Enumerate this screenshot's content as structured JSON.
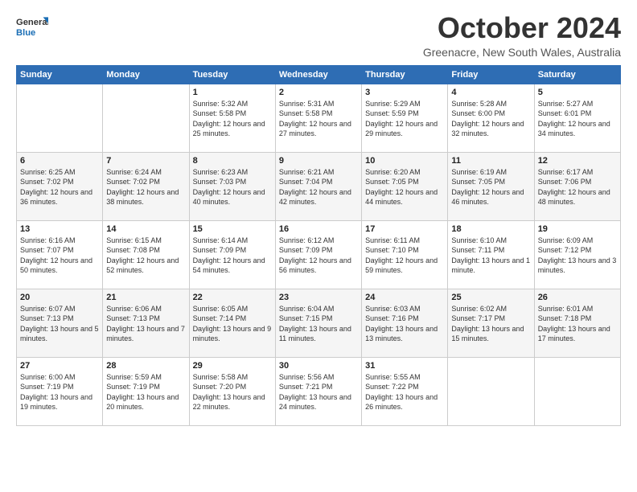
{
  "logo": {
    "general": "General",
    "blue": "Blue"
  },
  "header": {
    "month": "October 2024",
    "location": "Greenacre, New South Wales, Australia"
  },
  "weekdays": [
    "Sunday",
    "Monday",
    "Tuesday",
    "Wednesday",
    "Thursday",
    "Friday",
    "Saturday"
  ],
  "weeks": [
    [
      {
        "day": "",
        "sunrise": "",
        "sunset": "",
        "daylight": ""
      },
      {
        "day": "",
        "sunrise": "",
        "sunset": "",
        "daylight": ""
      },
      {
        "day": "1",
        "sunrise": "Sunrise: 5:32 AM",
        "sunset": "Sunset: 5:58 PM",
        "daylight": "Daylight: 12 hours and 25 minutes."
      },
      {
        "day": "2",
        "sunrise": "Sunrise: 5:31 AM",
        "sunset": "Sunset: 5:58 PM",
        "daylight": "Daylight: 12 hours and 27 minutes."
      },
      {
        "day": "3",
        "sunrise": "Sunrise: 5:29 AM",
        "sunset": "Sunset: 5:59 PM",
        "daylight": "Daylight: 12 hours and 29 minutes."
      },
      {
        "day": "4",
        "sunrise": "Sunrise: 5:28 AM",
        "sunset": "Sunset: 6:00 PM",
        "daylight": "Daylight: 12 hours and 32 minutes."
      },
      {
        "day": "5",
        "sunrise": "Sunrise: 5:27 AM",
        "sunset": "Sunset: 6:01 PM",
        "daylight": "Daylight: 12 hours and 34 minutes."
      }
    ],
    [
      {
        "day": "6",
        "sunrise": "Sunrise: 6:25 AM",
        "sunset": "Sunset: 7:02 PM",
        "daylight": "Daylight: 12 hours and 36 minutes."
      },
      {
        "day": "7",
        "sunrise": "Sunrise: 6:24 AM",
        "sunset": "Sunset: 7:02 PM",
        "daylight": "Daylight: 12 hours and 38 minutes."
      },
      {
        "day": "8",
        "sunrise": "Sunrise: 6:23 AM",
        "sunset": "Sunset: 7:03 PM",
        "daylight": "Daylight: 12 hours and 40 minutes."
      },
      {
        "day": "9",
        "sunrise": "Sunrise: 6:21 AM",
        "sunset": "Sunset: 7:04 PM",
        "daylight": "Daylight: 12 hours and 42 minutes."
      },
      {
        "day": "10",
        "sunrise": "Sunrise: 6:20 AM",
        "sunset": "Sunset: 7:05 PM",
        "daylight": "Daylight: 12 hours and 44 minutes."
      },
      {
        "day": "11",
        "sunrise": "Sunrise: 6:19 AM",
        "sunset": "Sunset: 7:05 PM",
        "daylight": "Daylight: 12 hours and 46 minutes."
      },
      {
        "day": "12",
        "sunrise": "Sunrise: 6:17 AM",
        "sunset": "Sunset: 7:06 PM",
        "daylight": "Daylight: 12 hours and 48 minutes."
      }
    ],
    [
      {
        "day": "13",
        "sunrise": "Sunrise: 6:16 AM",
        "sunset": "Sunset: 7:07 PM",
        "daylight": "Daylight: 12 hours and 50 minutes."
      },
      {
        "day": "14",
        "sunrise": "Sunrise: 6:15 AM",
        "sunset": "Sunset: 7:08 PM",
        "daylight": "Daylight: 12 hours and 52 minutes."
      },
      {
        "day": "15",
        "sunrise": "Sunrise: 6:14 AM",
        "sunset": "Sunset: 7:09 PM",
        "daylight": "Daylight: 12 hours and 54 minutes."
      },
      {
        "day": "16",
        "sunrise": "Sunrise: 6:12 AM",
        "sunset": "Sunset: 7:09 PM",
        "daylight": "Daylight: 12 hours and 56 minutes."
      },
      {
        "day": "17",
        "sunrise": "Sunrise: 6:11 AM",
        "sunset": "Sunset: 7:10 PM",
        "daylight": "Daylight: 12 hours and 59 minutes."
      },
      {
        "day": "18",
        "sunrise": "Sunrise: 6:10 AM",
        "sunset": "Sunset: 7:11 PM",
        "daylight": "Daylight: 13 hours and 1 minute."
      },
      {
        "day": "19",
        "sunrise": "Sunrise: 6:09 AM",
        "sunset": "Sunset: 7:12 PM",
        "daylight": "Daylight: 13 hours and 3 minutes."
      }
    ],
    [
      {
        "day": "20",
        "sunrise": "Sunrise: 6:07 AM",
        "sunset": "Sunset: 7:13 PM",
        "daylight": "Daylight: 13 hours and 5 minutes."
      },
      {
        "day": "21",
        "sunrise": "Sunrise: 6:06 AM",
        "sunset": "Sunset: 7:13 PM",
        "daylight": "Daylight: 13 hours and 7 minutes."
      },
      {
        "day": "22",
        "sunrise": "Sunrise: 6:05 AM",
        "sunset": "Sunset: 7:14 PM",
        "daylight": "Daylight: 13 hours and 9 minutes."
      },
      {
        "day": "23",
        "sunrise": "Sunrise: 6:04 AM",
        "sunset": "Sunset: 7:15 PM",
        "daylight": "Daylight: 13 hours and 11 minutes."
      },
      {
        "day": "24",
        "sunrise": "Sunrise: 6:03 AM",
        "sunset": "Sunset: 7:16 PM",
        "daylight": "Daylight: 13 hours and 13 minutes."
      },
      {
        "day": "25",
        "sunrise": "Sunrise: 6:02 AM",
        "sunset": "Sunset: 7:17 PM",
        "daylight": "Daylight: 13 hours and 15 minutes."
      },
      {
        "day": "26",
        "sunrise": "Sunrise: 6:01 AM",
        "sunset": "Sunset: 7:18 PM",
        "daylight": "Daylight: 13 hours and 17 minutes."
      }
    ],
    [
      {
        "day": "27",
        "sunrise": "Sunrise: 6:00 AM",
        "sunset": "Sunset: 7:19 PM",
        "daylight": "Daylight: 13 hours and 19 minutes."
      },
      {
        "day": "28",
        "sunrise": "Sunrise: 5:59 AM",
        "sunset": "Sunset: 7:19 PM",
        "daylight": "Daylight: 13 hours and 20 minutes."
      },
      {
        "day": "29",
        "sunrise": "Sunrise: 5:58 AM",
        "sunset": "Sunset: 7:20 PM",
        "daylight": "Daylight: 13 hours and 22 minutes."
      },
      {
        "day": "30",
        "sunrise": "Sunrise: 5:56 AM",
        "sunset": "Sunset: 7:21 PM",
        "daylight": "Daylight: 13 hours and 24 minutes."
      },
      {
        "day": "31",
        "sunrise": "Sunrise: 5:55 AM",
        "sunset": "Sunset: 7:22 PM",
        "daylight": "Daylight: 13 hours and 26 minutes."
      },
      {
        "day": "",
        "sunrise": "",
        "sunset": "",
        "daylight": ""
      },
      {
        "day": "",
        "sunrise": "",
        "sunset": "",
        "daylight": ""
      }
    ]
  ]
}
